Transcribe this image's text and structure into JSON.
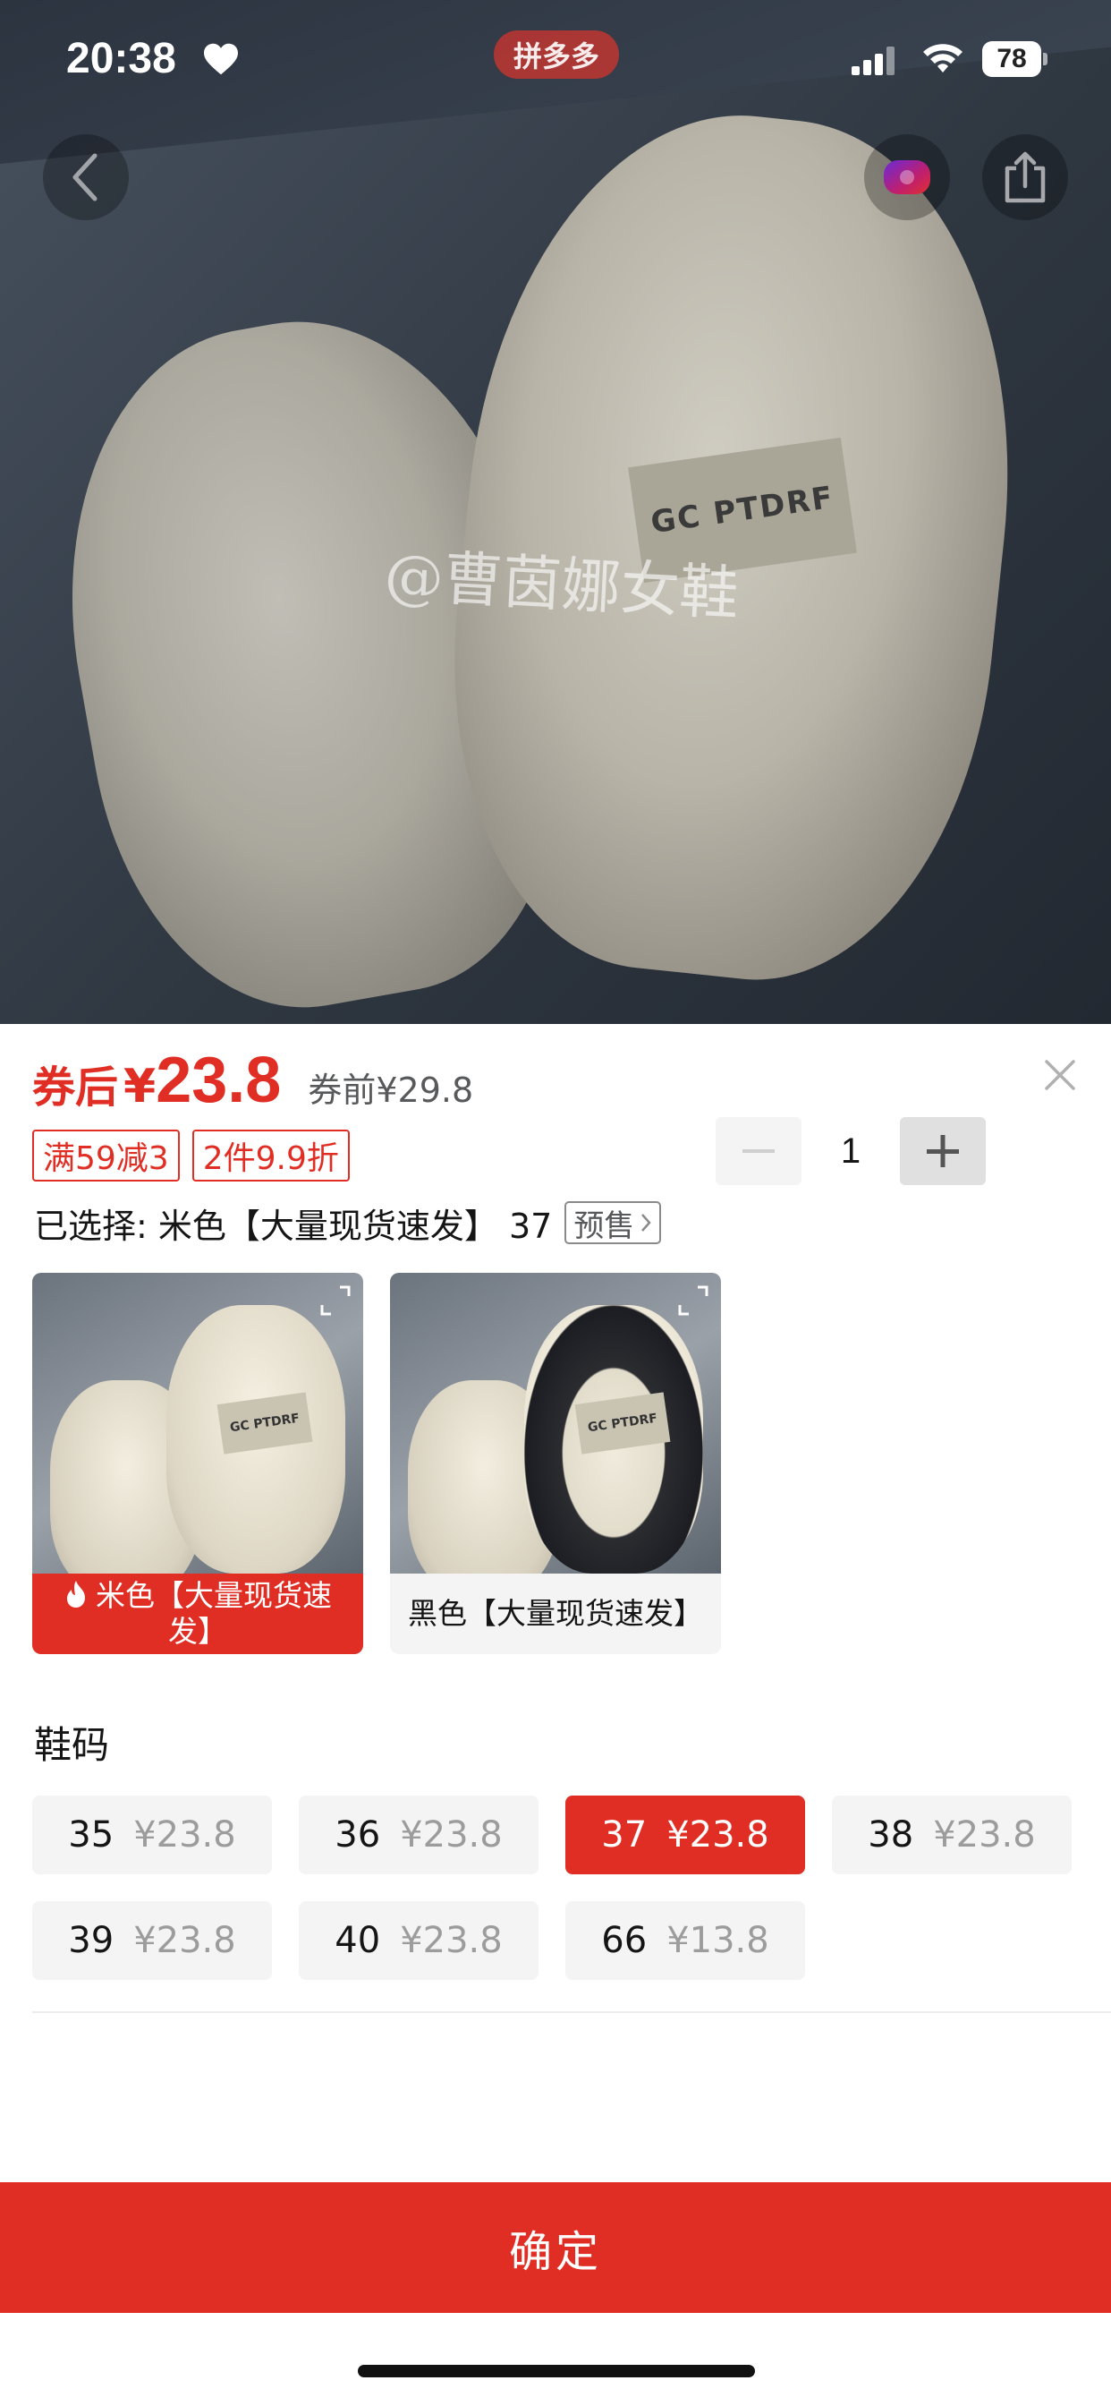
{
  "status_bar": {
    "time": "20:38",
    "app_badge": "拼多多",
    "battery": "78",
    "icons": [
      "heart-icon",
      "signal-icon",
      "wifi-icon",
      "battery-icon"
    ]
  },
  "hero": {
    "watermark": "@曹茵娜女鞋",
    "label_text": "GC PTDRF"
  },
  "nav": {
    "icons": [
      "back-icon",
      "live-camera-icon",
      "share-icon"
    ]
  },
  "price": {
    "after_coupon_label": "券后",
    "currency": "¥",
    "value": "23.8",
    "before_coupon": "券前¥29.8"
  },
  "tags": [
    "满59减3",
    "2件9.9折"
  ],
  "quantity": {
    "value": "1",
    "minus": "−",
    "plus": "+"
  },
  "selection": {
    "text": "已选择: 米色【大量现货速发】 37",
    "presale": "预售"
  },
  "colors": [
    {
      "label": "米色【大量现货速发】",
      "selected": true,
      "patch": "GC PTDRF"
    },
    {
      "label": "黑色【大量现货速发】",
      "selected": false,
      "patch": "GC PTDRF"
    }
  ],
  "sizes": {
    "title": "鞋码",
    "options": [
      {
        "size": "35",
        "price": "¥23.8",
        "selected": false
      },
      {
        "size": "36",
        "price": "¥23.8",
        "selected": false
      },
      {
        "size": "37",
        "price": "¥23.8",
        "selected": true
      },
      {
        "size": "38",
        "price": "¥23.8",
        "selected": false
      },
      {
        "size": "39",
        "price": "¥23.8",
        "selected": false
      },
      {
        "size": "40",
        "price": "¥23.8",
        "selected": false
      },
      {
        "size": "66",
        "price": "¥13.8",
        "selected": false
      }
    ]
  },
  "confirm_label": "确定",
  "theme": {
    "accent": "#e02e24"
  }
}
